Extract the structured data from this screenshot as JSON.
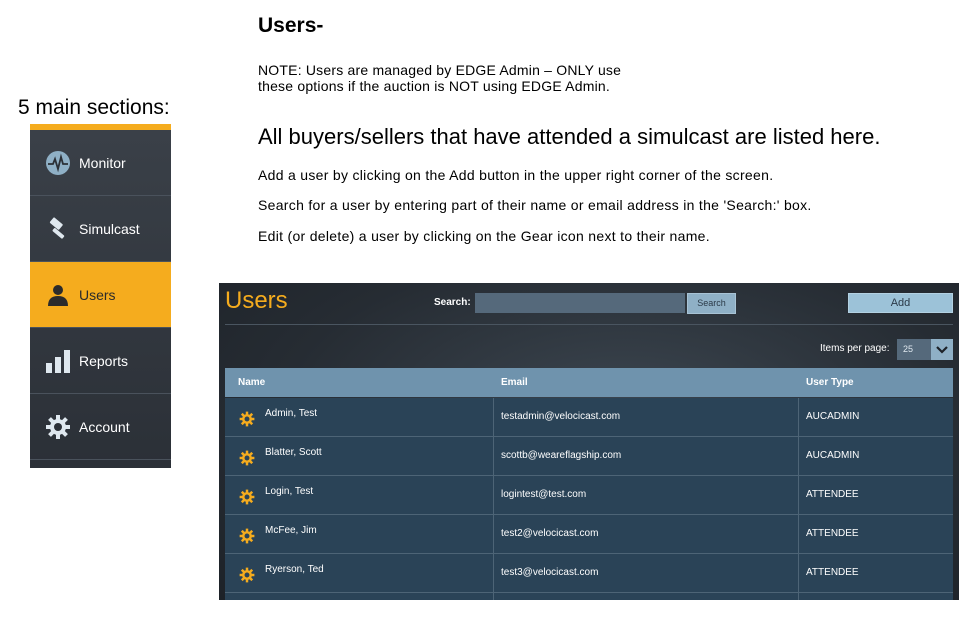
{
  "slide": {
    "title": "Users-",
    "note_line1": "NOTE: Users are managed by EDGE Admin – ONLY use",
    "note_line2": "these options if the auction is NOT using EDGE Admin.",
    "main_sections": "5 main sections:",
    "headline": "All buyers/sellers that have attended a simulcast are listed here.",
    "instructions": [
      "Add a user by clicking on the Add button in the upper right corner of the screen.",
      "Search for a user by entering part of their name or email address in the 'Search:' box.",
      "Edit (or delete) a user by clicking on the Gear icon next to their name."
    ]
  },
  "sidebar": {
    "accent": "#f5ac1e",
    "items": [
      {
        "label": "Monitor",
        "icon": "pulse-icon"
      },
      {
        "label": "Simulcast",
        "icon": "gavel-icon"
      },
      {
        "label": "Users",
        "icon": "user-icon",
        "active": true
      },
      {
        "label": "Reports",
        "icon": "bar-chart-icon"
      },
      {
        "label": "Account",
        "icon": "gear-icon"
      }
    ]
  },
  "app": {
    "title": "Users",
    "search_label": "Search:",
    "search_value": "",
    "search_button": "Search",
    "add_button": "Add",
    "items_per_page_label": "Items per page:",
    "items_per_page_value": "25",
    "columns": [
      "Name",
      "Email",
      "User Type"
    ],
    "rows": [
      {
        "name": "Admin, Test",
        "email": "testadmin@velocicast.com",
        "type": "AUCADMIN"
      },
      {
        "name": "Blatter, Scott",
        "email": "scottb@weareflagship.com",
        "type": "AUCADMIN"
      },
      {
        "name": "Login, Test",
        "email": "logintest@test.com",
        "type": "ATTENDEE"
      },
      {
        "name": "McFee, Jim",
        "email": "test2@velocicast.com",
        "type": "ATTENDEE"
      },
      {
        "name": "Ryerson, Ted",
        "email": "test3@velocicast.com",
        "type": "ATTENDEE"
      }
    ],
    "colors": {
      "title": "#f5ac1e",
      "header": "#6f93ad",
      "row": "#2a4357",
      "gear": "#f5ac1e"
    }
  }
}
